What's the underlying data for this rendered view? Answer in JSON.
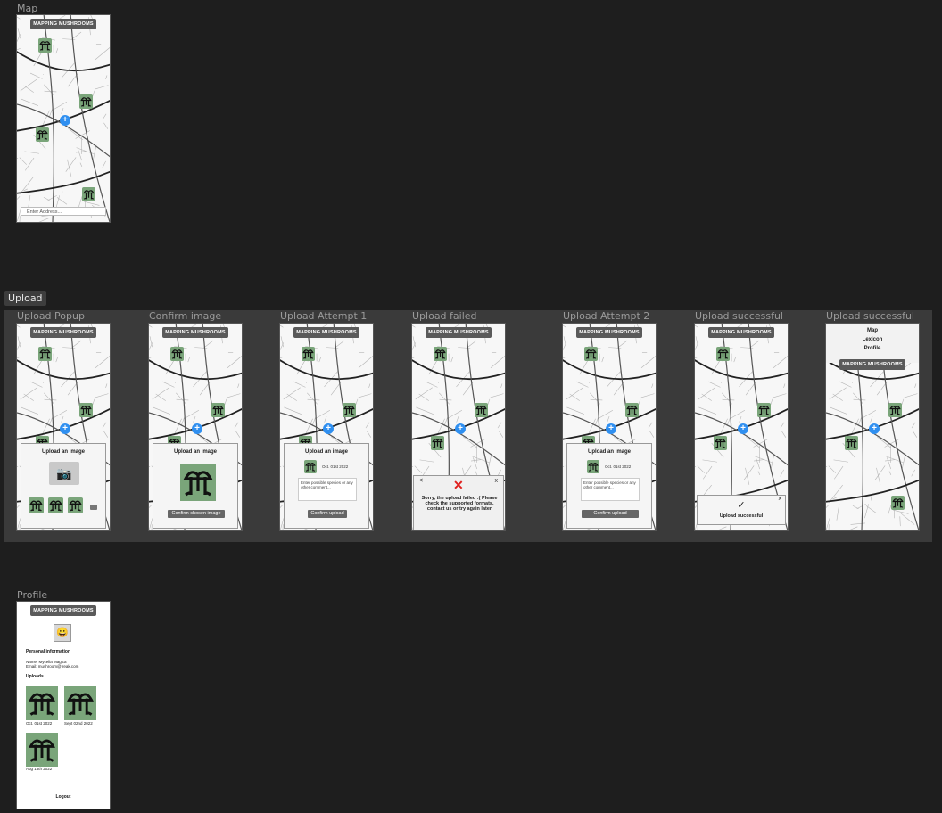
{
  "app_title": "MAPPING MUSHROOMS",
  "frames": {
    "map": "Map",
    "upload_popup": "Upload Popup",
    "confirm_image": "Confirm image",
    "upload_attempt_1": "Upload Attempt 1",
    "upload_failed": "Upload failed",
    "upload_attempt_2": "Upload Attempt 2",
    "upload_successful_1": "Upload successful",
    "upload_successful_2": "Upload successful",
    "profile": "Profile"
  },
  "section": {
    "upload": "Upload"
  },
  "address_placeholder": "Enter Address...",
  "upload_popup": {
    "title": "Upload an image",
    "camera_icon": "camera-icon"
  },
  "confirm": {
    "title": "Upload an image",
    "button": "Confirm chosen image"
  },
  "attempt": {
    "title": "Upload an image",
    "date": "Oct. 01st 2022",
    "comment_placeholder": "Enter possible species or any other comment...",
    "button": "Confirm upload"
  },
  "failed": {
    "back": "<",
    "close": "x",
    "message": "Sorry, the upload failed :( Please check the supported formats, contact us or try again later"
  },
  "success": {
    "check": "✓",
    "close": "x",
    "message": "Upload successful"
  },
  "menu": {
    "items": [
      "Map",
      "Lexicon",
      "Profile"
    ]
  },
  "profile": {
    "avatar": "😀",
    "personal_heading": "Personal information",
    "name_line": "Name: Mycelia Magica",
    "email_line": "Email: mushroom@freak.com",
    "uploads_heading": "Uploads",
    "uploads": [
      {
        "date": "Oct. 01st 2022"
      },
      {
        "date": "Sept 02nd 2022"
      },
      {
        "date": "Aug 15th 2022"
      }
    ],
    "logout": "Logout"
  },
  "colors": {
    "pin_green": "#7aa57a",
    "add_blue": "#2f8ff0",
    "error_red": "#e0201e"
  }
}
